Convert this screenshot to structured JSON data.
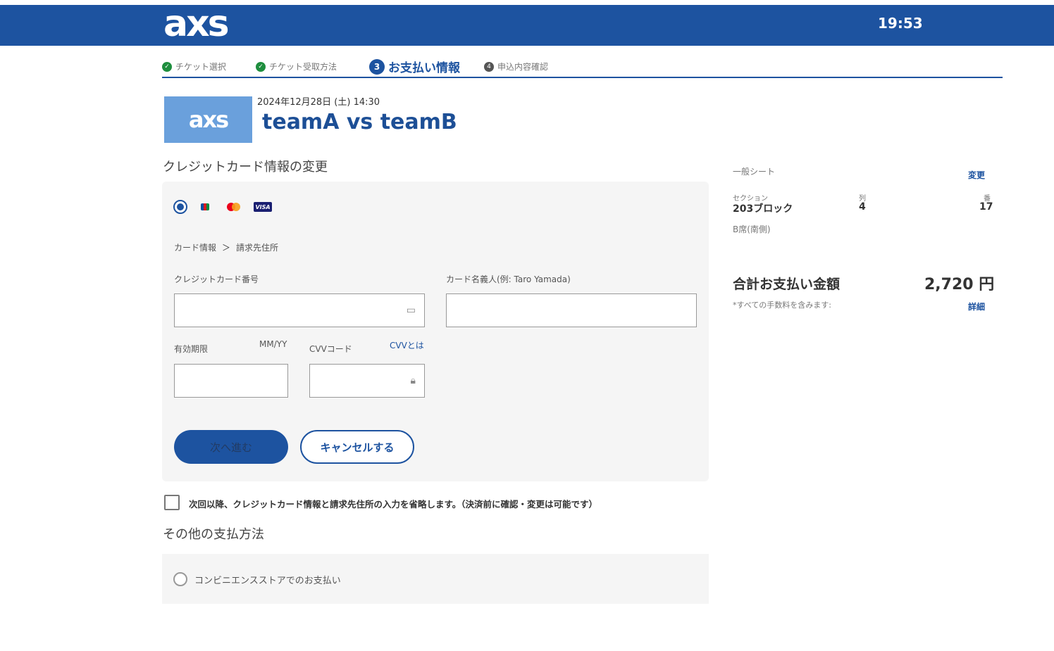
{
  "header": {
    "logo": "axs",
    "timer": "19:53",
    "brand_color": "#1d53a0"
  },
  "steps": [
    {
      "label": "チケット選択",
      "status": "done",
      "mark": "✓"
    },
    {
      "label": "チケット受取方法",
      "status": "done",
      "mark": "✓"
    },
    {
      "label": "お支払い情報",
      "status": "active",
      "mark": "3"
    },
    {
      "label": "申込内容確認",
      "status": "todo",
      "mark": "4"
    }
  ],
  "event": {
    "thumb_logo": "axs",
    "date": "2024年12月28日 (土) 14:30",
    "title": "teamA vs teamB"
  },
  "card_section": {
    "title": "クレジットカード情報の変更",
    "brands": [
      "jcb-icon",
      "mastercard-icon",
      "visa-icon"
    ],
    "visa_text": "VISA",
    "breadcrumb": {
      "step1": "カード情報",
      "sep": "＞",
      "step2": "請求先住所"
    },
    "card_number_label": "クレジットカード番号",
    "card_number_value": "",
    "holder_label": "カード名義人(例: Taro Yamada)",
    "holder_value": "",
    "expiry_label": "有効期限",
    "expiry_format": "MM/YY",
    "expiry_value": "",
    "cvv_label": "CVVコード",
    "cvv_link": "CVVとは",
    "cvv_value": "",
    "next_button": "次へ進む",
    "cancel_button": "キャンセルする"
  },
  "save_option": {
    "checked": false,
    "label": "次回以降、クレジットカード情報と請求先住所の入力を省略します。（決済前に確認・変更は可能です）"
  },
  "other_methods": {
    "title": "その他の支払方法",
    "convenience_store": "コンビニエンスストアでのお支払い"
  },
  "summary": {
    "seat_type": "一般シート",
    "change_link": "変更",
    "section_label": "セクション",
    "section_value": "203ブロック",
    "row_label": "列",
    "row_value": "4",
    "seat_label": "番",
    "seat_value": "17",
    "area": "B席(南側)",
    "total_label": "合計お支払い金額",
    "total_value": "2,720 円",
    "fee_note": "*すべての手数料を含みます:",
    "detail_link": "詳細"
  }
}
